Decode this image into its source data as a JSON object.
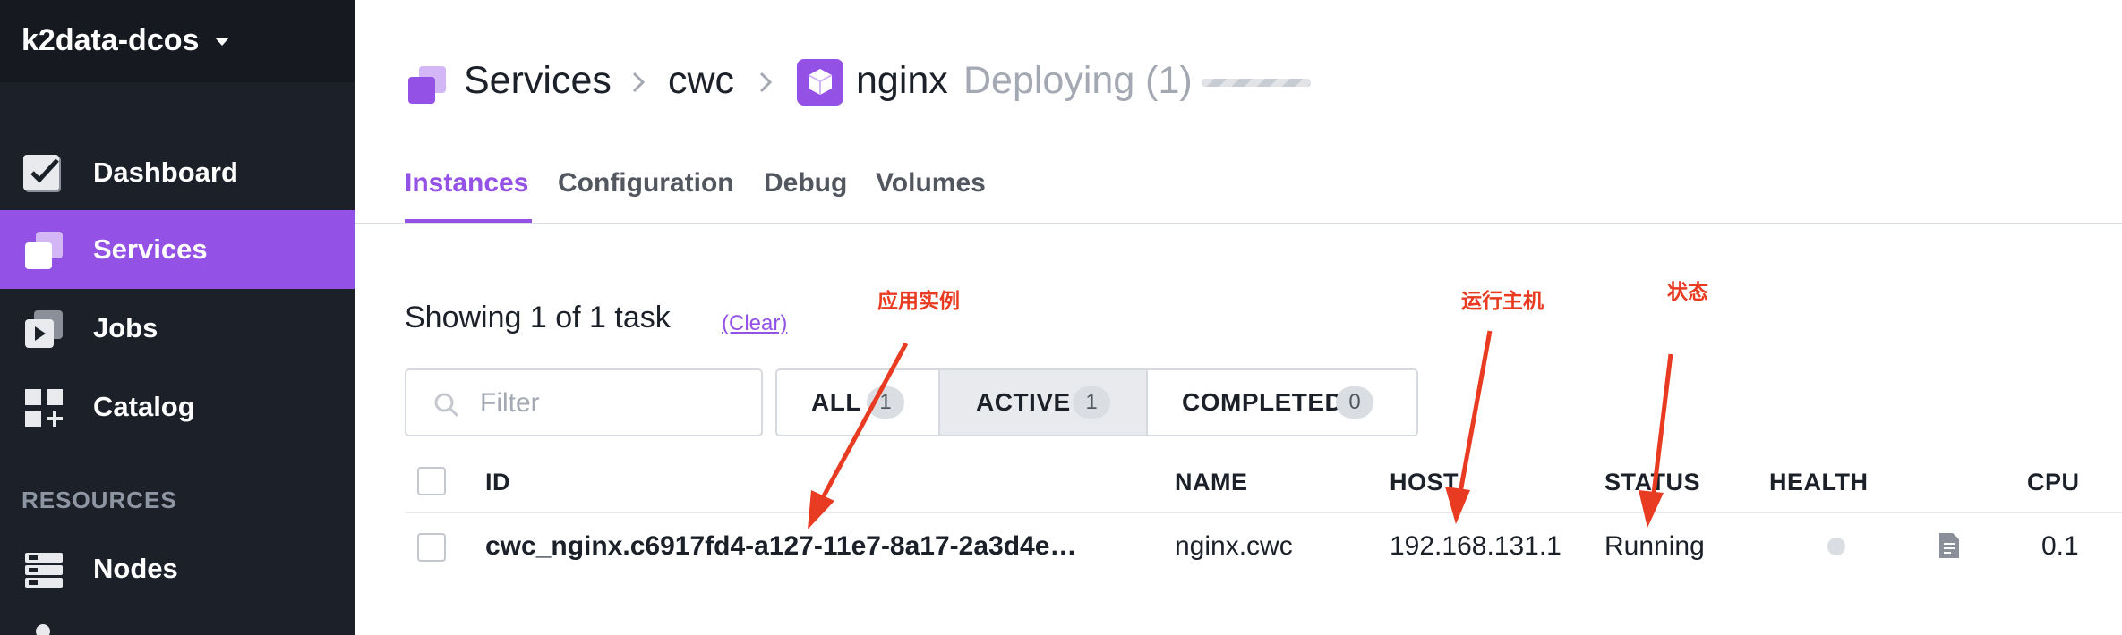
{
  "sidebar": {
    "cluster_name": "k2data-dcos",
    "items": [
      {
        "label": "Dashboard",
        "icon": "dashboard-icon"
      },
      {
        "label": "Services",
        "icon": "services-icon",
        "active": true
      },
      {
        "label": "Jobs",
        "icon": "jobs-icon"
      },
      {
        "label": "Catalog",
        "icon": "catalog-icon"
      }
    ],
    "resources_label": "RESOURCES",
    "resources_items": [
      {
        "label": "Nodes",
        "icon": "nodes-icon"
      }
    ]
  },
  "breadcrumb": {
    "root": "Services",
    "group": "cwc",
    "service": "nginx",
    "status": "Deploying (1)"
  },
  "tabs": [
    "Instances",
    "Configuration",
    "Debug",
    "Volumes"
  ],
  "summary": {
    "showing_text": "Showing 1 of 1 task",
    "clear_label": "(Clear)"
  },
  "filter": {
    "placeholder": "Filter"
  },
  "status_filters": [
    {
      "label": "ALL",
      "count": "1"
    },
    {
      "label": "ACTIVE",
      "count": "1",
      "selected": true
    },
    {
      "label": "COMPLETED",
      "count": "0"
    }
  ],
  "table": {
    "columns": [
      "ID",
      "NAME",
      "HOST",
      "STATUS",
      "HEALTH",
      "CPU"
    ],
    "rows": [
      {
        "id": "cwc_nginx.c6917fd4-a127-11e7-8a17-2a3d4e…",
        "name": "nginx.cwc",
        "host": "192.168.131.1",
        "status": "Running",
        "cpu": "0.1"
      }
    ]
  },
  "annotations": {
    "instance": "应用实例",
    "host": "运行主机",
    "status": "状态",
    "color": "#e83b21"
  },
  "colors": {
    "accent": "#9351e5",
    "sidebar_bg": "#1b2029"
  }
}
